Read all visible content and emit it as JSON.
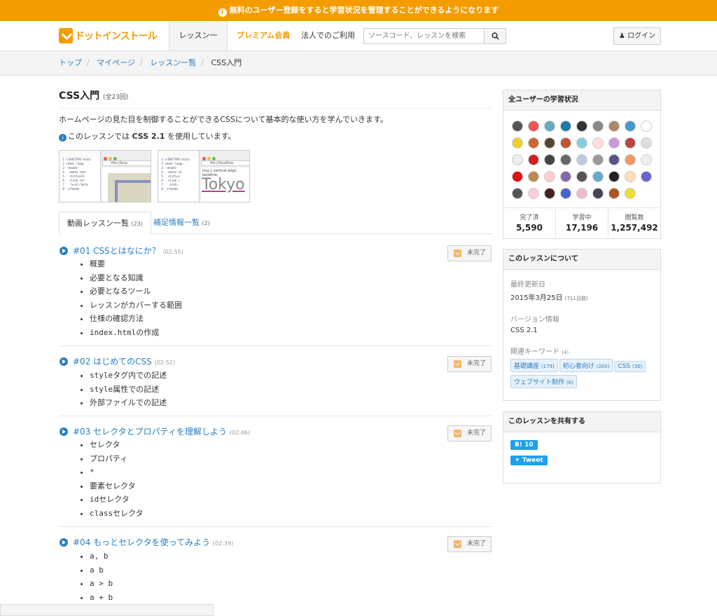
{
  "banner": {
    "text": "無料のユーザー登録をすると学習状況を管理することができるようになります"
  },
  "nav": {
    "logo": "ドットインストール",
    "lessons": "レッスン一覧",
    "premium": "プレミアム会員",
    "corporate": "法人でのご利用",
    "search_placeholder": "ソースコード、レッスンを検索",
    "login": "ログイン"
  },
  "breadcrumb": {
    "items": [
      "トップ",
      "マイページ",
      "レッスン一覧",
      "CSS入門"
    ]
  },
  "lesson": {
    "title": "CSS入門",
    "count": "(全23回)",
    "description": "ホームページの見た目を制御することができるCSSについて基本的な使い方を学んでいきます。",
    "version_prefix": "このレッスンでは",
    "version": "CSS 2.1",
    "version_suffix": "を使用しています。"
  },
  "thumbs": [
    {
      "tab": "index.html",
      "tab2": "CSS Practice",
      "url": "file://loca"
    },
    {
      "tab": "index.html",
      "tab2": "CSS Practice",
      "url": "file://localhos",
      "code": "img { vertical-align: baseline;",
      "preview": "Tokyo"
    }
  ],
  "tabs": [
    {
      "label": "動画レッスン一覧",
      "count": "(23)"
    },
    {
      "label": "補足情報一覧",
      "count": "(2)"
    }
  ],
  "lessons": [
    {
      "title": "#01 CSSとはなにか？",
      "duration": "(02:55)",
      "status": "未完了",
      "topics": [
        "概要",
        "必要となる知識",
        "必要となるツール",
        "レッスンがカバーする範囲",
        "仕様の確認方法",
        "index.htmlの作成"
      ]
    },
    {
      "title": "#02 はじめてのCSS",
      "duration": "(02:52)",
      "status": "未完了",
      "topics": [
        "styleタグ内での記述",
        "style属性での記述",
        "外部ファイルでの記述"
      ]
    },
    {
      "title": "#03 セレクタとプロパティを理解しよう",
      "duration": "(02:46)",
      "status": "未完了",
      "topics": [
        "セレクタ",
        "プロパティ",
        "*",
        "要素セレクタ",
        "idセレクタ",
        "classセレクタ"
      ]
    },
    {
      "title": "#04 もっとセレクタを使ってみよう",
      "duration": "(02:39)",
      "status": "未完了",
      "topics": [
        "a, b",
        "a b",
        "a > b",
        "a + b"
      ]
    }
  ],
  "side": {
    "progress_title": "全ユーザーの学習状況",
    "avatar_colors": [
      "#555",
      "#e55",
      "#6ab",
      "#27a",
      "#333",
      "#888",
      "#a86",
      "#49c",
      "#fff",
      "#ec3",
      "#c63",
      "#543",
      "#b53",
      "#8cd",
      "#fdd",
      "#c9d",
      "#b44",
      "#ddd",
      "#eee",
      "#c22",
      "#444",
      "#666",
      "#bcd",
      "#999",
      "#558",
      "#e96",
      "#eee",
      "#d11",
      "#b85",
      "#fcc",
      "#86a",
      "#555",
      "#6ac",
      "#222",
      "#fdb",
      "#66c",
      "#555",
      "#fcd",
      "#422",
      "#46c",
      "#ebc",
      "#445",
      "#a52",
      "#ed3"
    ],
    "stats": [
      {
        "label": "完了済",
        "value": "5,590"
      },
      {
        "label": "学習中",
        "value": "17,196"
      },
      {
        "label": "閲覧数",
        "value": "1,257,492"
      }
    ],
    "about_title": "このレッスンについて",
    "updated_label": "最終更新日",
    "updated": "2015年3月25日",
    "updated_ago": "(711日前)",
    "version_label": "バージョン情報",
    "version": "CSS 2.1",
    "keywords_label": "関連キーワード",
    "keywords_count": "(4)",
    "keywords": [
      {
        "name": "基礎講座",
        "count": "(179)"
      },
      {
        "name": "初心者向け",
        "count": "(200)"
      },
      {
        "name": "CSS",
        "count": "(30)"
      },
      {
        "name": "ウェブサイト制作",
        "count": "(6)"
      }
    ],
    "share_title": "このレッスンを共有する",
    "hatena": "B! 10",
    "tweet": "Tweet"
  }
}
